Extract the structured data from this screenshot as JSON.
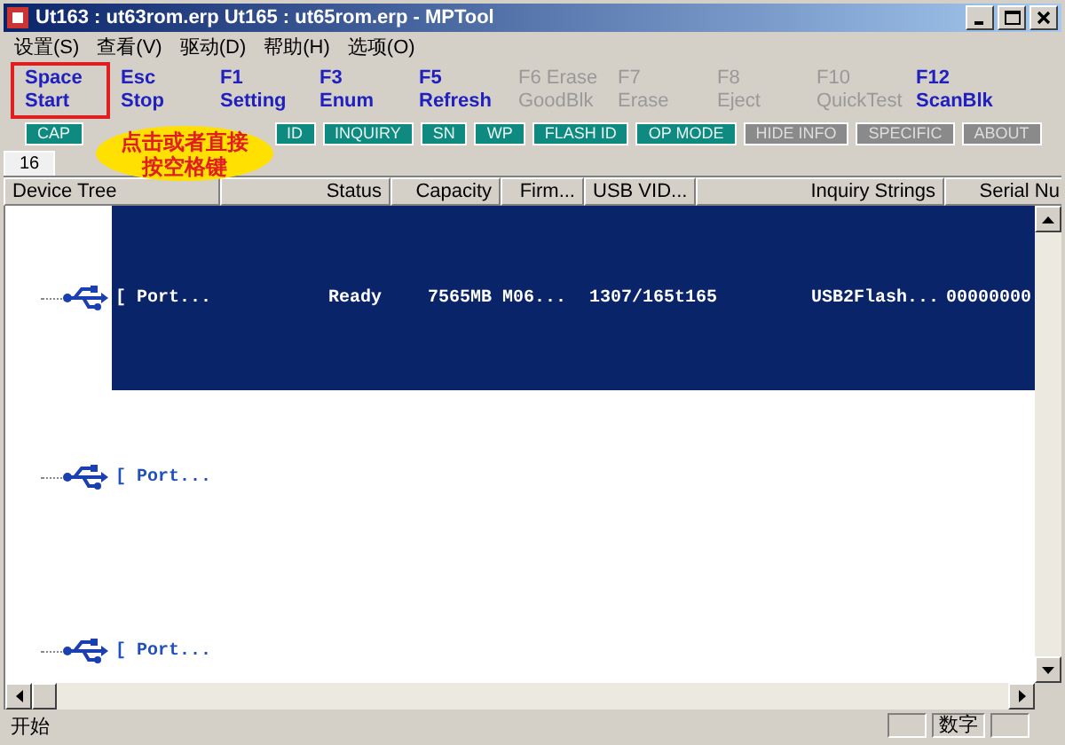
{
  "window": {
    "title": "Ut163 : ut63rom.erp Ut165 : ut65rom.erp  - MPTool"
  },
  "menu": [
    "设置(S)",
    "查看(V)",
    "驱动(D)",
    "帮助(H)",
    "选项(O)"
  ],
  "function_keys": [
    {
      "key": "Space",
      "label": "Start",
      "disabled": false,
      "highlighted": true
    },
    {
      "key": "Esc",
      "label": "Stop",
      "disabled": false,
      "highlighted": false
    },
    {
      "key": "F1",
      "label": "Setting",
      "disabled": false,
      "highlighted": false
    },
    {
      "key": "F3",
      "label": "Enum",
      "disabled": false,
      "highlighted": false
    },
    {
      "key": "F5",
      "label": "Refresh",
      "disabled": false,
      "highlighted": false
    },
    {
      "key": "F6 Erase",
      "label": "GoodBlk",
      "disabled": true,
      "highlighted": false
    },
    {
      "key": "F7",
      "label": "Erase",
      "disabled": true,
      "highlighted": false
    },
    {
      "key": "F8",
      "label": "Eject",
      "disabled": true,
      "highlighted": false
    },
    {
      "key": "F10",
      "label": "QuickTest",
      "disabled": true,
      "highlighted": false
    },
    {
      "key": "F12",
      "label": "ScanBlk",
      "disabled": false,
      "highlighted": false
    }
  ],
  "info_buttons": [
    {
      "label": "CAP",
      "disabled": false
    },
    {
      "label": "ID",
      "disabled": false
    },
    {
      "label": "INQUIRY",
      "disabled": false
    },
    {
      "label": "SN",
      "disabled": false
    },
    {
      "label": "WP",
      "disabled": false
    },
    {
      "label": "FLASH ID",
      "disabled": false
    },
    {
      "label": "OP MODE",
      "disabled": false
    },
    {
      "label": "HIDE INFO",
      "disabled": true
    },
    {
      "label": "SPECIFIC",
      "disabled": true
    },
    {
      "label": "ABOUT",
      "disabled": true
    }
  ],
  "tabs": [
    {
      "label": "16",
      "selected": true
    }
  ],
  "callout": {
    "text": "点击或者直接按空格键"
  },
  "table": {
    "columns": [
      "Device Tree",
      "Status",
      "Capacity",
      "Firm...",
      "USB VID...",
      "Inquiry Strings",
      "Serial Nu"
    ],
    "rows": [
      {
        "selected": true,
        "cells": [
          "[ Port...",
          "Ready",
          "7565MB",
          "M06...",
          "1307/165t165",
          "USB2Flash...",
          "00000000"
        ]
      },
      {
        "selected": false,
        "cells": [
          "[ Port..."
        ]
      },
      {
        "selected": false,
        "cells": [
          "[ Port..."
        ]
      }
    ]
  },
  "status_bar": {
    "text": "开始",
    "indicator": "数字"
  }
}
